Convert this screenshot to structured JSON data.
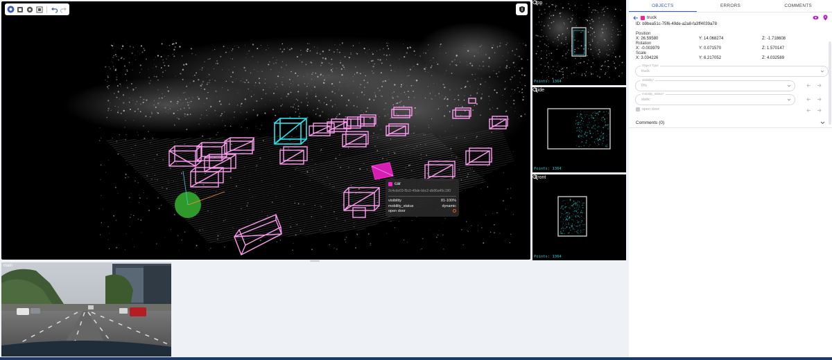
{
  "viewport": {
    "toolbar": {
      "tools": [
        "pan-tool-icon",
        "box-tool-icon",
        "polygon-tool-icon",
        "fit-icon"
      ],
      "undo": "undo-icon",
      "redo": "redo-icon"
    },
    "corner_button": "shield-icon"
  },
  "tooltip": {
    "class": "car",
    "class_color": "#ff1fcf",
    "id": "2c4cde03-f5c0-49de-bbc2-db86a45c190",
    "rows": [
      {
        "key": "visibility",
        "value": "81-100%"
      },
      {
        "key": "mobility_status",
        "value": "dynamic"
      },
      {
        "key": "open door",
        "value": ""
      }
    ]
  },
  "mini_views": [
    {
      "title": "Top",
      "points": "Points: 1364"
    },
    {
      "title": "Side",
      "points": "Points: 1364"
    },
    {
      "title": "Front",
      "points": "Points: 1364"
    }
  ],
  "camera": {
    "label": "main"
  },
  "panel": {
    "tabs": [
      "OBJECTS",
      "ERRORS",
      "COMMENTS"
    ],
    "active_tab": "OBJECTS",
    "object": {
      "class": "truck",
      "color": "#ff1f8e",
      "id_text": "ID: b9bea51c-75f6-49de-a2a8-fa3ff4039a78",
      "position_label": "Position",
      "position": [
        "X: 26.59580",
        "Y: 14.068274",
        "Z: -1.718608"
      ],
      "rotation_label": "Rotation",
      "rotation": [
        "X: -0.003979",
        "Y: 0.071570",
        "Z: 1.570147"
      ],
      "scale_label": "Scale",
      "scale": [
        "X: 3.034226",
        "Y: 6.217052",
        "Z: 4.032589"
      ]
    },
    "fields": {
      "object_type": {
        "legend": "Object Type",
        "value": "truck"
      },
      "visibility": {
        "legend": "visibility*",
        "value": "0%"
      },
      "mobility": {
        "legend": "mobility_status*",
        "value": "static"
      },
      "open_door": "open door"
    },
    "comments": "Comments (0)"
  },
  "colors": {
    "accent": "#3857c9",
    "cuboid": "#ff9cf2",
    "selected": "#22e8f0",
    "highlight": "#ff1fcf"
  }
}
